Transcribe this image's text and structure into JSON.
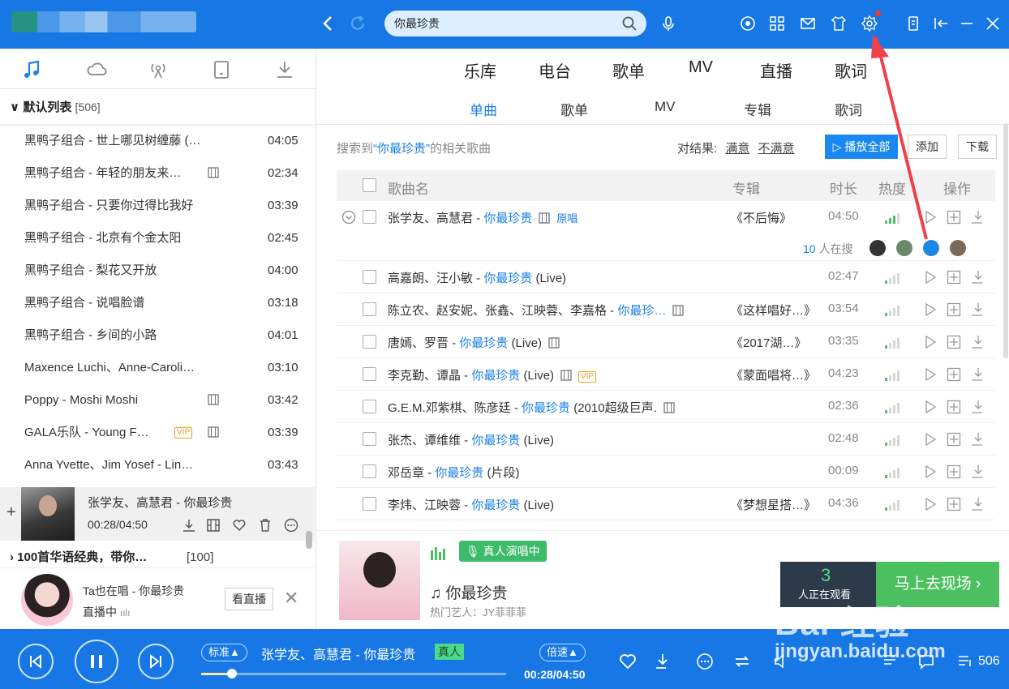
{
  "search": {
    "query": "你最珍贵"
  },
  "main_tabs": [
    "乐库",
    "电台",
    "歌单",
    "MV",
    "直播",
    "歌词"
  ],
  "sub_tabs": [
    "单曲",
    "歌单",
    "MV",
    "专辑",
    "歌词"
  ],
  "result_info": {
    "prefix": "搜索到",
    "query": "“你最珍贵”",
    "suffix": "的相关歌曲",
    "feedback_label": "对结果:",
    "satisfied": "满意",
    "unsatisfied": "不满意"
  },
  "actions": {
    "play_all": "播放全部",
    "add": "添加",
    "download": "下载"
  },
  "table_headers": {
    "title": "歌曲名",
    "album": "专辑",
    "duration": "时长",
    "heat": "热度",
    "ops": "操作"
  },
  "songs": [
    {
      "artist": "张学友、高慧君 - ",
      "song": "你最珍贵",
      "extra": "",
      "album": "《不后悔》",
      "duration": "04:50",
      "heat": 3,
      "tag": "原唱"
    },
    {
      "artist": "高嘉朗、汪小敏 - ",
      "song": "你最珍贵",
      "extra": " (Live)",
      "album": "",
      "duration": "02:47",
      "heat": 1
    },
    {
      "artist": "陈立农、赵安妮、张鑫、江映蓉、李嘉格 - ",
      "song": "你最珍…",
      "extra": "",
      "album": "《这样唱好…》",
      "duration": "03:54",
      "heat": 1
    },
    {
      "artist": "唐嫣、罗晋 - ",
      "song": "你最珍贵",
      "extra": " (Live)",
      "album": "《2017湖…》",
      "duration": "03:35",
      "heat": 1
    },
    {
      "artist": "李克勤、谭晶 - ",
      "song": "你最珍贵",
      "extra": " (Live)",
      "album": "《蒙面唱将…》",
      "duration": "04:23",
      "heat": 1
    },
    {
      "artist": "G.E.M.邓紫棋、陈彦廷 - ",
      "song": "你最珍贵",
      "extra": " (2010超级巨声.",
      "album": "",
      "duration": "02:36",
      "heat": 1
    },
    {
      "artist": "张杰、谭维维 - ",
      "song": "你最珍贵",
      "extra": " (Live)",
      "album": "",
      "duration": "02:48",
      "heat": 1
    },
    {
      "artist": "邓岳章 - ",
      "song": "你最珍贵",
      "extra": " (片段)",
      "album": "",
      "duration": "00:09",
      "heat": 1
    },
    {
      "artist": "李炜、江映蓉 - ",
      "song": "你最珍贵",
      "extra": " (Live)",
      "album": "《梦想星搭…》",
      "duration": "04:36",
      "heat": 1
    }
  ],
  "searching": {
    "count": "10",
    "label": " 人在搜"
  },
  "left": {
    "list_title": "默认列表",
    "list_count": "[506]",
    "items": [
      {
        "title": "黑鸭子组合 - 世上哪见树缠藤 (…",
        "duration": "04:05"
      },
      {
        "title": "黑鸭子组合 - 年轻的朋友来…",
        "duration": "02:34"
      },
      {
        "title": "黑鸭子组合 - 只要你过得比我好",
        "duration": "03:39"
      },
      {
        "title": "黑鸭子组合 - 北京有个金太阳",
        "duration": "02:45"
      },
      {
        "title": "黑鸭子组合 - 梨花又开放",
        "duration": "04:00"
      },
      {
        "title": "黑鸭子组合 - 说唱脸谱",
        "duration": "03:18"
      },
      {
        "title": "黑鸭子组合 - 乡间的小路",
        "duration": "04:01"
      },
      {
        "title": "Maxence Luchi、Anne-Caroli…",
        "duration": "03:10"
      },
      {
        "title": "Poppy - Moshi Moshi",
        "duration": "03:42"
      },
      {
        "title": "GALA乐队 - Young F…",
        "duration": "03:39",
        "vip": "VIP"
      },
      {
        "title": "Anna Yvette、Jim Yosef - Lin…",
        "duration": "03:43"
      }
    ],
    "now_playing": {
      "title": "张学友、高慧君 - 你最珍贵",
      "time": "00:28/04:50"
    },
    "group2": {
      "title": "100首华语经典，带你…",
      "count": "[100]"
    },
    "live": {
      "line1": "Ta也在唱 - 你最珍贵",
      "line2": "直播中",
      "button": "看直播"
    }
  },
  "promo": {
    "tag": "真人演唱中",
    "song": "你最珍贵",
    "artist": "热门艺人：JY菲菲菲",
    "viewers": "3",
    "viewers_label": "人正在观看",
    "go": "马上去现场 ›"
  },
  "player": {
    "quality": "标准",
    "title": "张学友、高慧君 - 你最珍贵",
    "badge": "真人",
    "speed": "倍速",
    "time": "00:28/04:50",
    "progress": 0.1,
    "count": "506"
  },
  "watermark": {
    "main": "Bai 经验",
    "sub": "jingyan.baidu.com"
  },
  "colors": {
    "accent": "#1a7fe6",
    "titlebar": "#1677e5",
    "live_green": "#3dbb6a"
  }
}
